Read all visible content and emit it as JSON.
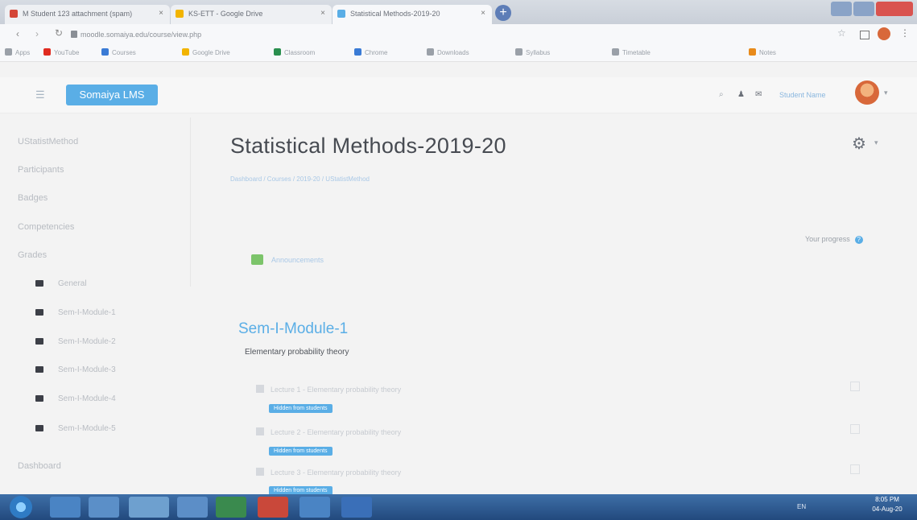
{
  "browser": {
    "tabs": [
      {
        "label": "M  Student 123 attachment (spam)",
        "color": "#d44638"
      },
      {
        "label": "KS-ETT - Google Drive",
        "color": "#f2b400"
      },
      {
        "label": "Statistical Methods-2019-20",
        "color": "#5aaee6"
      }
    ],
    "address": "moodle.somaiya.edu/course/view.php",
    "bookmarks": [
      {
        "label": "Apps",
        "color": "#9aa0a8"
      },
      {
        "label": "YouTube",
        "color": "#e02b20"
      },
      {
        "label": "Courses",
        "color": "#3a7bd5"
      },
      {
        "label": "Google Drive",
        "color": "#f2b400"
      },
      {
        "label": "Classroom",
        "color": "#2a8f4e"
      },
      {
        "label": "Chrome",
        "color": "#3a7bd5"
      },
      {
        "label": "Downloads",
        "color": "#9aa0a8"
      },
      {
        "label": "Syllabus",
        "color": "#9aa0a8"
      },
      {
        "label": "Timetable",
        "color": "#9aa0a8"
      },
      {
        "label": "Notes",
        "color": "#e88a1a"
      }
    ]
  },
  "navbar": {
    "brand": "Somaiya LMS",
    "user_name": "Student Name",
    "hamburger_icon": "menu-icon"
  },
  "leftnav": {
    "items": [
      "UStatistMethod",
      "Participants",
      "Badges",
      "Competencies",
      "Grades"
    ],
    "folders": [
      "General",
      "Sem-I-Module-1",
      "Sem-I-Module-2",
      "Sem-I-Module-3",
      "Sem-I-Module-4",
      "Sem-I-Module-5"
    ],
    "dashboard": "Dashboard"
  },
  "main": {
    "title": "Statistical Methods-2019-20",
    "breadcrumb": "Dashboard / Courses / 2019-20 / UStatistMethod",
    "your_progress": "Your progress",
    "news": "Announcements",
    "section_title": "Sem-I-Module-1",
    "section_summary": "Elementary probability theory",
    "activities": [
      {
        "label": "Lecture 1 - Elementary probability theory",
        "badge": "Hidden from students"
      },
      {
        "label": "Lecture 2 - Elementary probability theory",
        "badge": "Hidden from students"
      },
      {
        "label": "Lecture 3 - Elementary probability theory",
        "badge": "Hidden from students"
      }
    ]
  },
  "taskbar": {
    "time": "8:05 PM",
    "date": "04-Aug-20",
    "tray_text": "EN"
  },
  "colors": {
    "accent": "#5aaee6",
    "taskbar": "#2a5590"
  }
}
